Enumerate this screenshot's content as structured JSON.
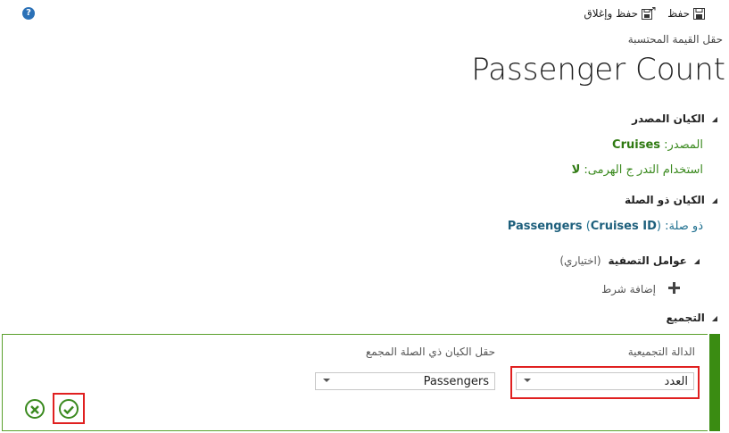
{
  "toolbar": {
    "help_label": "?",
    "save_label": "حفظ",
    "save_close_label": "حفظ وإغلاق"
  },
  "header": {
    "subtitle": "حقل القيمة المحتسبة",
    "title": "Passenger Count"
  },
  "source_entity": {
    "section_label": "الكيان المصدر",
    "source_label": "المصدر:",
    "source_value": "Cruises",
    "hierarchy_label": "استخدام التدر ج الهرمى:",
    "hierarchy_value": "لا"
  },
  "related_entity": {
    "section_label": "الكيان ذو الصلة",
    "related_label": "ذو صلة:",
    "entity_name": "Passengers",
    "open_paren": "(",
    "lookup_field": "Cruises ID",
    "close_paren": ")"
  },
  "filters": {
    "section_label": "عوامل التصفية",
    "optional_label": "(اختياري)",
    "add_condition_label": "إضافة شرط"
  },
  "aggregation": {
    "section_label": "التجميع",
    "function_label": "الدالة التجميعية",
    "function_value": "العدد",
    "field_label": "حقل الكيان ذي الصلة المجمع",
    "field_value": "Passengers"
  },
  "colors": {
    "accent_green": "#3a8c12",
    "highlight_red": "#e02020",
    "link_teal": "#1e6f8f"
  }
}
